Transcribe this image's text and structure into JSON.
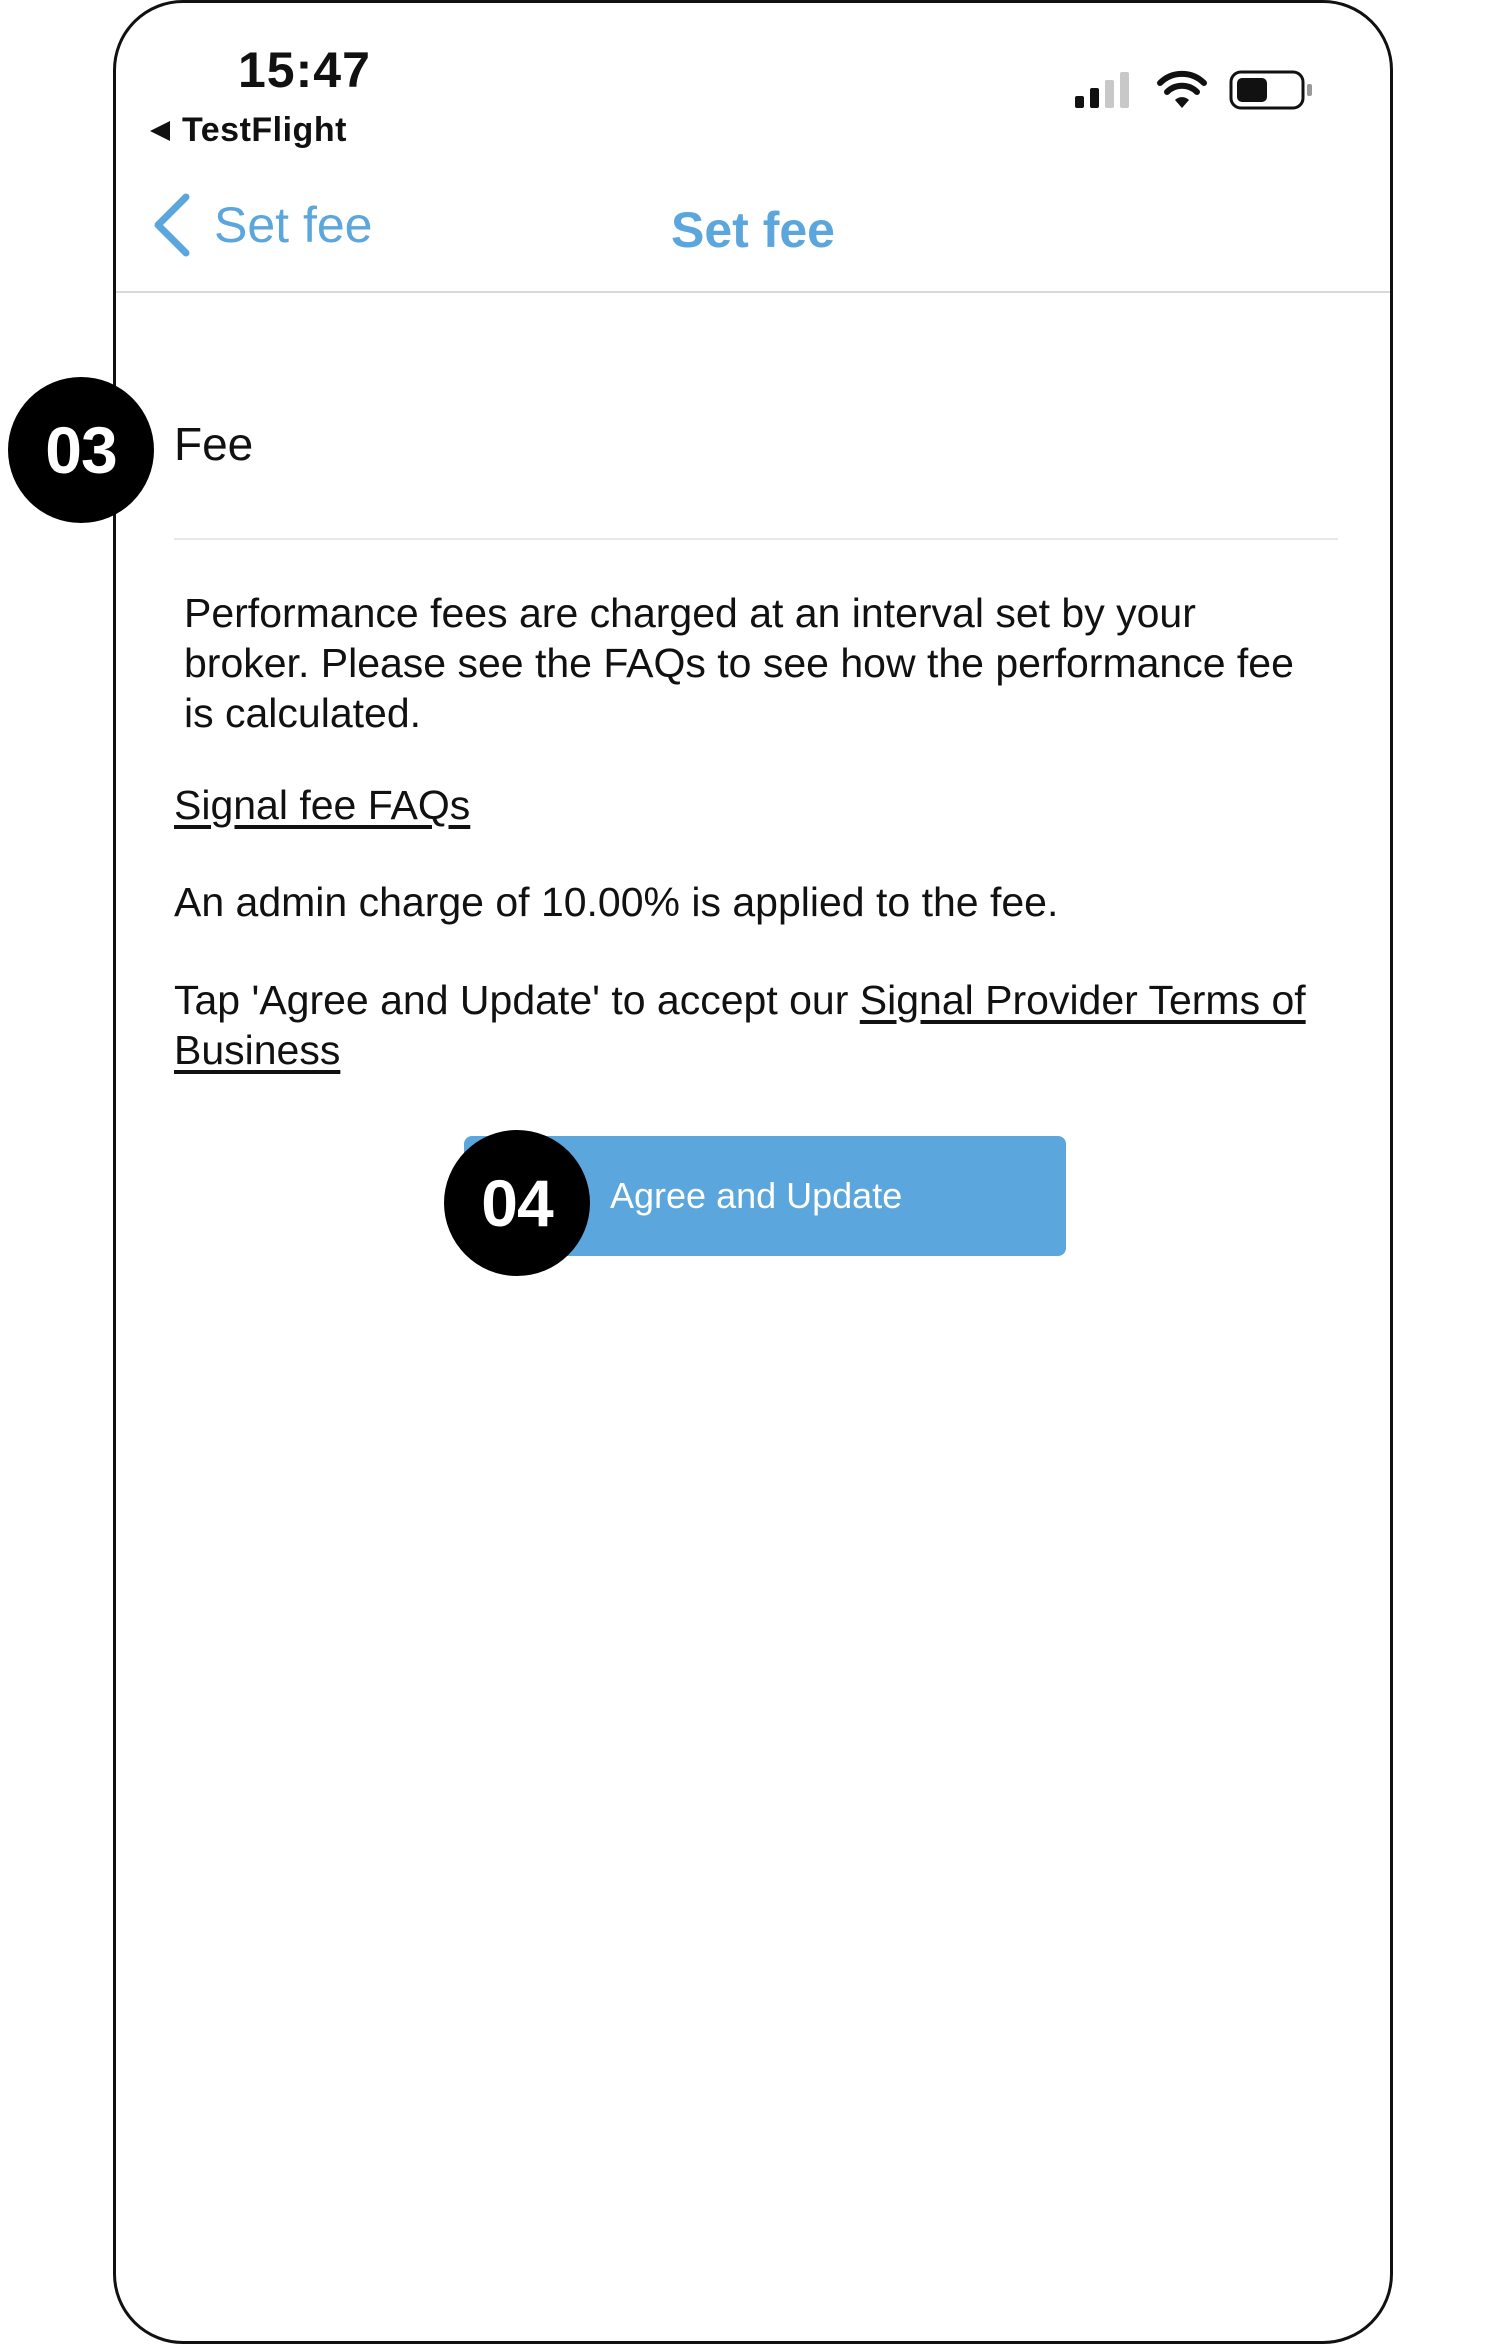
{
  "status_bar": {
    "time": "15:47",
    "back_app": "TestFlight",
    "icons": [
      "signal-icon",
      "wifi-icon",
      "battery-icon"
    ]
  },
  "navbar": {
    "back_label": "Set fee",
    "title": "Set fee"
  },
  "content": {
    "fee_label": "Fee",
    "description": "Performance fees are charged at an interval set by your broker. Please see the FAQs to see how the performance fee is calculated.",
    "faq_link": "Signal fee FAQs",
    "admin_charge": "An admin charge of 10.00% is applied to the fee.",
    "terms_prefix": "Tap 'Agree and Update' to accept our ",
    "terms_link": "Signal Provider Terms of Business",
    "agree_button": "Agree and Update"
  },
  "annotations": {
    "badge_1": "03",
    "badge_2": "04"
  },
  "colors": {
    "accent": "#5ba6dc",
    "text": "#111111",
    "badge": "#000000"
  }
}
